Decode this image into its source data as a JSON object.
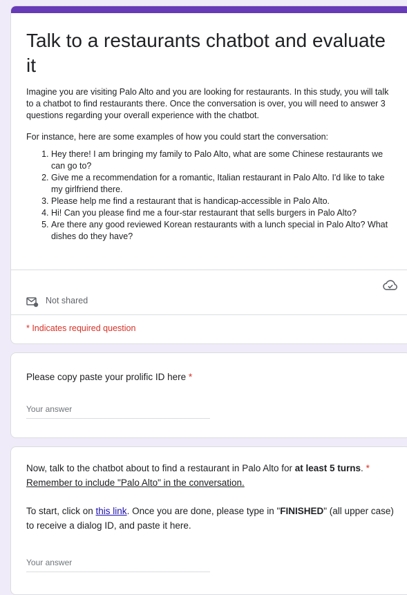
{
  "header": {
    "title": "Talk to a restaurants chatbot and evaluate it",
    "intro": "Imagine you are visiting Palo Alto and you are looking for restaurants. In this study, you will talk to a chatbot to find restaurants there. Once the conversation is over, you will need to answer 3 questions regarding your overall experience with the chatbot.",
    "examples_intro": "For instance, here are some examples of how you could start the conversation:",
    "examples": [
      "Hey there! I am bringing my family to Palo Alto, what are some Chinese restaurants we can go to?",
      "Give me a recommendation for a romantic, Italian restaurant in Palo Alto. I'd like to take my girlfriend there.",
      "Please help me find a restaurant that is handicap-accessible in Palo Alto.",
      "Hi! Can you please find me a four-star restaurant that sells burgers in Palo Alto?",
      "Are there any good reviewed Korean restaurants with a lunch special in Palo Alto? What dishes do they have?"
    ],
    "sharing": "Not shared",
    "required_note": "* Indicates required question"
  },
  "question1": {
    "label": "Please copy paste your prolific ID here",
    "star": "*",
    "placeholder": "Your answer"
  },
  "question2": {
    "text_a": "Now, talk to the chatbot about to find a restaurant in Palo Alto for ",
    "text_bold": "at least 5 turns",
    "text_b": ". ",
    "star": "*",
    "reminder": "Remember to include \"Palo Alto\" in the conversation.",
    "start_a": "To start, click on ",
    "link": "this link",
    "start_b": ". Once you are done, please type in \"",
    "finished": "FINISHED",
    "start_c": "\" (all upper case) to receive a dialog ID, and paste it here.",
    "placeholder": "Your answer"
  },
  "colors": {
    "accent": "#673ab7",
    "required": "#d93025",
    "link": "#1a0dab"
  },
  "icons": {
    "cloud": "cloud-saved-icon",
    "mail": "mail-lock-icon"
  }
}
